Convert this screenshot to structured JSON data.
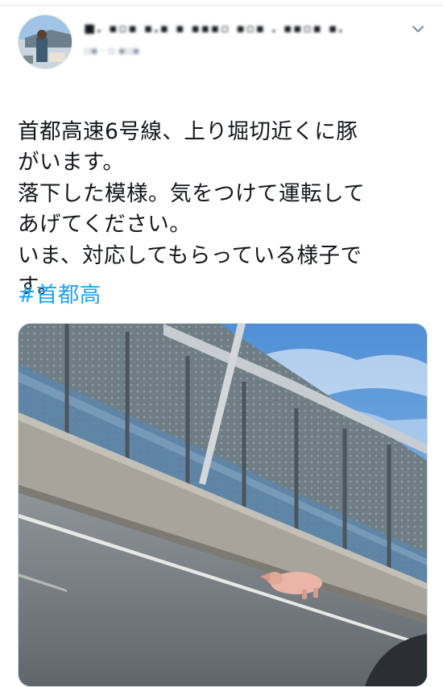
{
  "tweet": {
    "author_name": "■. ▪▫▪ ▪.▪ ▪ ▪▪▪▫ ▪▫▪ . ▪▪▫▪ ▪.",
    "author_handle": "▫▪ · ▫ ▪▫▪",
    "menu_icon": "chevron-down-icon",
    "text_lines": [
      "首都高速6号線、上り堀切近くに豚",
      "がいます。",
      "落下した模様。気をつけて運転して",
      "あげてください。",
      "いま、対応してもらっている様子で",
      "す。"
    ],
    "hashtag": "#首都高",
    "colors": {
      "hashtag": "#1da1f2",
      "text": "#14171a",
      "divider": "#e6ecf0"
    }
  }
}
